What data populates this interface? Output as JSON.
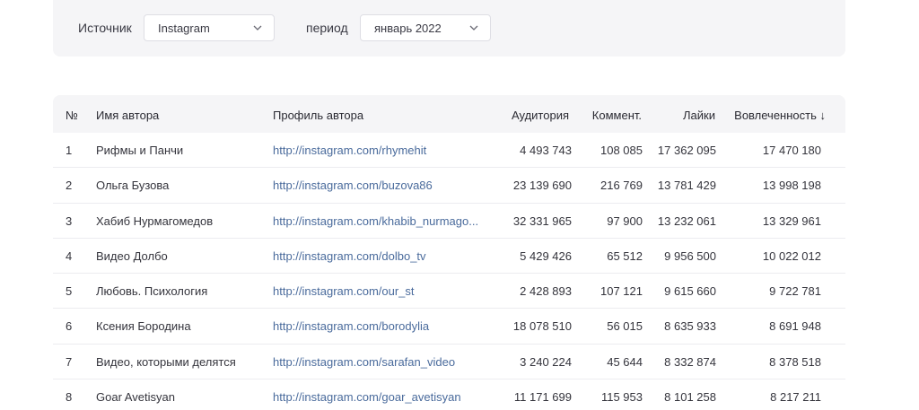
{
  "filters": {
    "source_label": "Источник",
    "source_value": "Instagram",
    "period_label": "период",
    "period_value": "январь 2022"
  },
  "table": {
    "headers": {
      "num": "№",
      "name": "Имя автора",
      "profile": "Профиль автора",
      "audience": "Аудитория",
      "comments": "Коммент.",
      "likes": "Лайки",
      "engagement": "Вовлеченность",
      "sort_arrow": "↓"
    },
    "rows": [
      {
        "num": "1",
        "name": "Рифмы и Панчи",
        "profile": "http://instagram.com/rhymehit",
        "audience": "4 493 743",
        "comments": "108 085",
        "likes": "17 362 095",
        "engagement": "17 470 180"
      },
      {
        "num": "2",
        "name": "Ольга Бузова",
        "profile": "http://instagram.com/buzova86",
        "audience": "23 139 690",
        "comments": "216 769",
        "likes": "13 781 429",
        "engagement": "13 998 198"
      },
      {
        "num": "3",
        "name": "Хабиб Нурмагомедов",
        "profile": "http://instagram.com/khabib_nurmago...",
        "audience": "32 331 965",
        "comments": "97 900",
        "likes": "13 232 061",
        "engagement": "13 329 961"
      },
      {
        "num": "4",
        "name": "Видео Долбо",
        "profile": "http://instagram.com/dolbo_tv",
        "audience": "5 429 426",
        "comments": "65 512",
        "likes": "9 956 500",
        "engagement": "10 022 012"
      },
      {
        "num": "5",
        "name": "Любовь. Психология",
        "profile": "http://instagram.com/our_st",
        "audience": "2 428 893",
        "comments": "107 121",
        "likes": "9 615 660",
        "engagement": "9 722 781"
      },
      {
        "num": "6",
        "name": "Ксения Бородина",
        "profile": "http://instagram.com/borodylia",
        "audience": "18 078 510",
        "comments": "56 015",
        "likes": "8 635 933",
        "engagement": "8 691 948"
      },
      {
        "num": "7",
        "name": "Видео, которыми делятся",
        "profile": "http://instagram.com/sarafan_video",
        "audience": "3 240 224",
        "comments": "45 644",
        "likes": "8 332 874",
        "engagement": "8 378 518"
      },
      {
        "num": "8",
        "name": "Goar Avetisyan",
        "profile": "http://instagram.com/goar_avetisyan",
        "audience": "11 171 699",
        "comments": "115 953",
        "likes": "8 101 258",
        "engagement": "8 217 211"
      }
    ]
  },
  "colors": {
    "panel_bg": "#f5f5f7",
    "link": "#4a6b9c",
    "text": "#2b2b33"
  },
  "icons": {
    "select_chevron": "chevron-down-icon",
    "sort": "arrow-down-icon"
  }
}
